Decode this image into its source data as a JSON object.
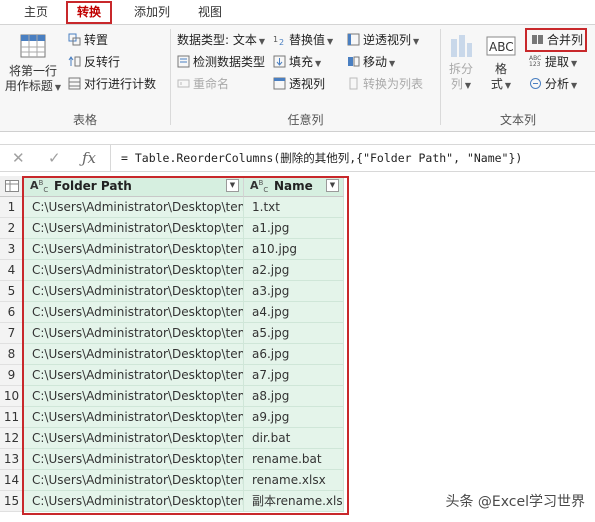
{
  "tabs": [
    "主页",
    "转换",
    "添加列",
    "视图"
  ],
  "ribbon": {
    "table_group": {
      "label": "表格",
      "first_row_header": [
        "将第一行",
        "用作标题"
      ],
      "transpose": "转置",
      "reverse_rows": "反转行",
      "count_rows": "对行进行计数"
    },
    "any_column_group": {
      "label": "任意列",
      "data_type": "数据类型: 文本",
      "detect_type": "检测数据类型",
      "rename": "重命名",
      "replace_values": "替换值",
      "fill": "填充",
      "pivot": "透视列",
      "unpivot": "逆透视列",
      "move": "移动",
      "convert_to_list": "转换为列表"
    },
    "text_group": {
      "label": "文本列",
      "split": [
        "拆分",
        "列"
      ],
      "format": [
        "格",
        "式"
      ],
      "merge": "合并列",
      "extract": "提取",
      "parse": "分析"
    }
  },
  "formula_bar": {
    "formula": "= Table.ReorderColumns(删除的其他列,{\"Folder Path\", \"Name\"})"
  },
  "table": {
    "columns": [
      "Folder Path",
      "Name"
    ],
    "type_icon": "ABC",
    "rows": [
      {
        "n": "1",
        "path": "C:\\Users\\Administrator\\Desktop\\temp\\",
        "name": "1.txt"
      },
      {
        "n": "2",
        "path": "C:\\Users\\Administrator\\Desktop\\temp\\",
        "name": "a1.jpg"
      },
      {
        "n": "3",
        "path": "C:\\Users\\Administrator\\Desktop\\temp\\",
        "name": "a10.jpg"
      },
      {
        "n": "4",
        "path": "C:\\Users\\Administrator\\Desktop\\temp\\",
        "name": "a2.jpg"
      },
      {
        "n": "5",
        "path": "C:\\Users\\Administrator\\Desktop\\temp\\",
        "name": "a3.jpg"
      },
      {
        "n": "6",
        "path": "C:\\Users\\Administrator\\Desktop\\temp\\",
        "name": "a4.jpg"
      },
      {
        "n": "7",
        "path": "C:\\Users\\Administrator\\Desktop\\temp\\",
        "name": "a5.jpg"
      },
      {
        "n": "8",
        "path": "C:\\Users\\Administrator\\Desktop\\temp\\",
        "name": "a6.jpg"
      },
      {
        "n": "9",
        "path": "C:\\Users\\Administrator\\Desktop\\temp\\",
        "name": "a7.jpg"
      },
      {
        "n": "10",
        "path": "C:\\Users\\Administrator\\Desktop\\temp\\",
        "name": "a8.jpg"
      },
      {
        "n": "11",
        "path": "C:\\Users\\Administrator\\Desktop\\temp\\",
        "name": "a9.jpg"
      },
      {
        "n": "12",
        "path": "C:\\Users\\Administrator\\Desktop\\temp\\",
        "name": "dir.bat"
      },
      {
        "n": "13",
        "path": "C:\\Users\\Administrator\\Desktop\\temp\\",
        "name": "rename.bat"
      },
      {
        "n": "14",
        "path": "C:\\Users\\Administrator\\Desktop\\temp\\",
        "name": "rename.xlsx"
      },
      {
        "n": "15",
        "path": "C:\\Users\\Administrator\\Desktop\\temp\\",
        "name": "副本rename.xlsx"
      }
    ]
  },
  "watermark": "头条 @Excel学习世界",
  "colors": {
    "highlight_red": "#c8282b",
    "selected_col_bg": "#e4f4ea",
    "accent_blue": "#3a7bc8"
  }
}
